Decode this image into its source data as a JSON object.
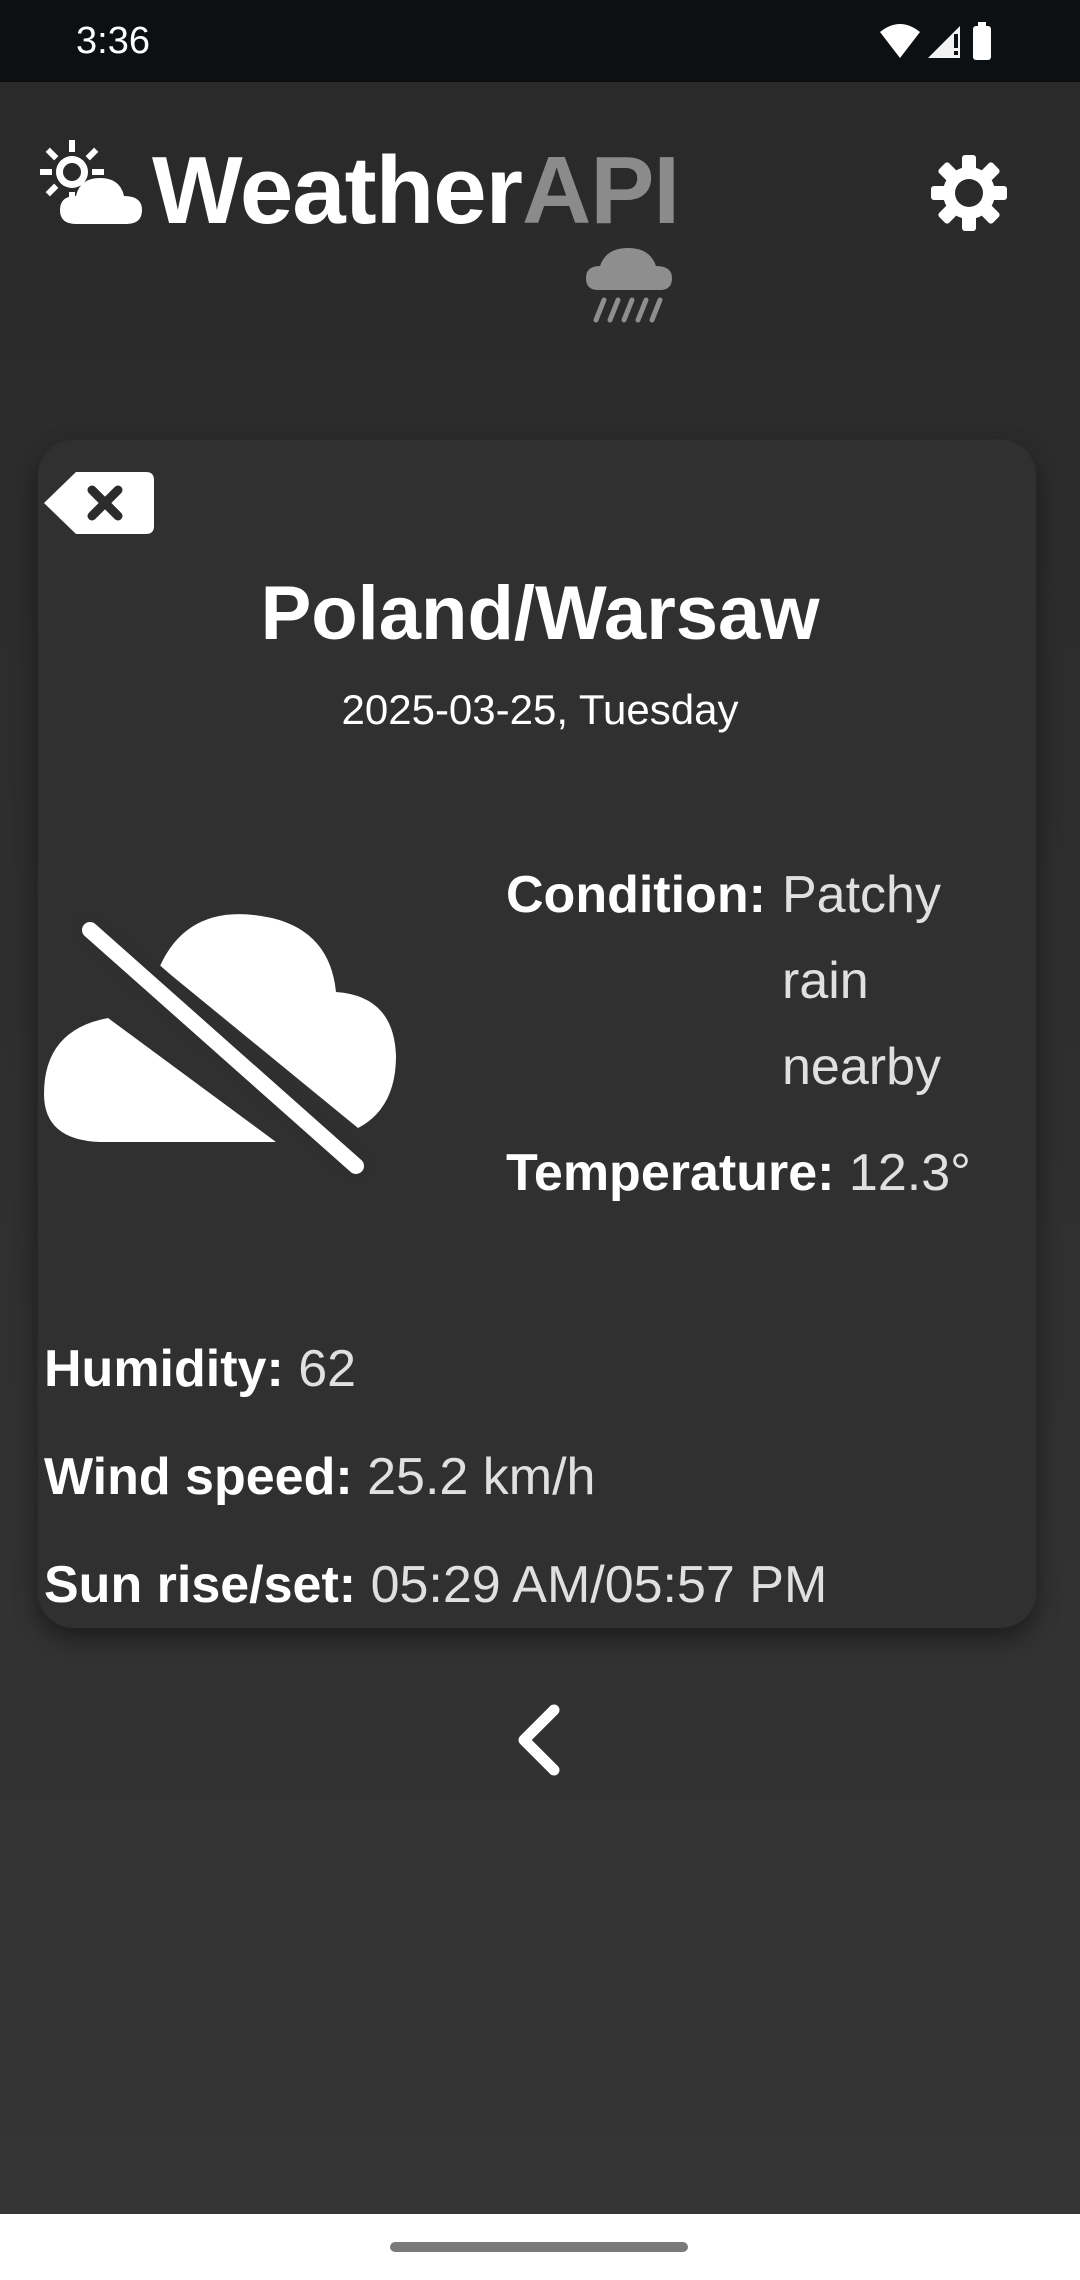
{
  "status_bar": {
    "time": "3:36",
    "icons": [
      "wifi-icon",
      "cellular-signal-icon",
      "battery-icon"
    ]
  },
  "header": {
    "logo_part_a": "Weather",
    "logo_part_b": "API",
    "logo_icons": [
      "sun-cloud-icon",
      "rain-cloud-icon"
    ],
    "settings_icon": "gear-icon"
  },
  "card": {
    "delete_icon": "backspace-x-icon",
    "location": "Poland/Warsaw",
    "date": "2025-03-25, Tuesday",
    "condition_icon": "cloud-off-icon",
    "condition_label": "Condition:",
    "condition_value": "Patchy rain nearby",
    "temperature_label": "Temperature:",
    "temperature_value": "12.3°",
    "humidity_label": "Humidity:",
    "humidity_value": "62",
    "wind_label": "Wind speed:",
    "wind_value": "25.2 km/h",
    "sun_label": "Sun rise/set:",
    "sun_value": "05:29 AM/05:57 PM"
  },
  "navigation": {
    "back_icon": "chevron-left-icon"
  },
  "colors": {
    "background": "#2c2c2c",
    "card": "#303030",
    "logo_accent": "#8b8b8b",
    "status_bar": "#0d1012",
    "text": "#ffffff"
  }
}
